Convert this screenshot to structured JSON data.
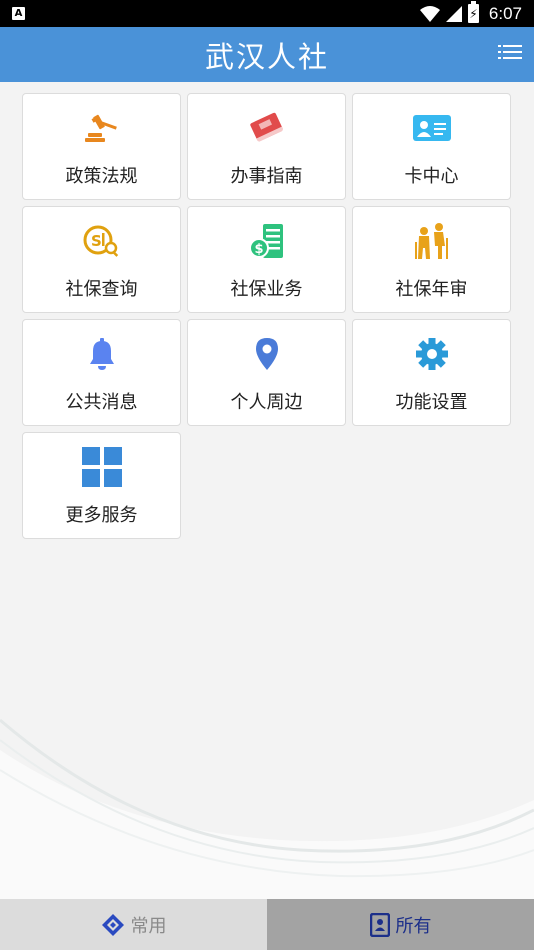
{
  "status_bar": {
    "app_icon_letter": "A",
    "time": "6:07"
  },
  "header": {
    "title": "武汉人社"
  },
  "tiles": [
    {
      "label": "政策法规",
      "icon": "gavel-icon",
      "color": "#e8871e"
    },
    {
      "label": "办事指南",
      "icon": "book-icon",
      "color": "#e14b4b"
    },
    {
      "label": "卡中心",
      "icon": "id-card-icon",
      "color": "#36b8f0"
    },
    {
      "label": "社保查询",
      "icon": "social-security-search-icon",
      "color": "#e0a10f"
    },
    {
      "label": "社保业务",
      "icon": "money-document-icon",
      "color": "#2ec27e"
    },
    {
      "label": "社保年审",
      "icon": "elderly-couple-icon",
      "color": "#e8a21a"
    },
    {
      "label": "公共消息",
      "icon": "bell-icon",
      "color": "#5a83f0"
    },
    {
      "label": "个人周边",
      "icon": "location-pin-icon",
      "color": "#4a7bd8"
    },
    {
      "label": "功能设置",
      "icon": "gear-icon",
      "color": "#2a9ad8"
    },
    {
      "label": "更多服务",
      "icon": "grid-icon",
      "color": "#3a8ad8"
    }
  ],
  "tabbar": {
    "common_label": "常用",
    "all_label": "所有",
    "selected": "all"
  }
}
